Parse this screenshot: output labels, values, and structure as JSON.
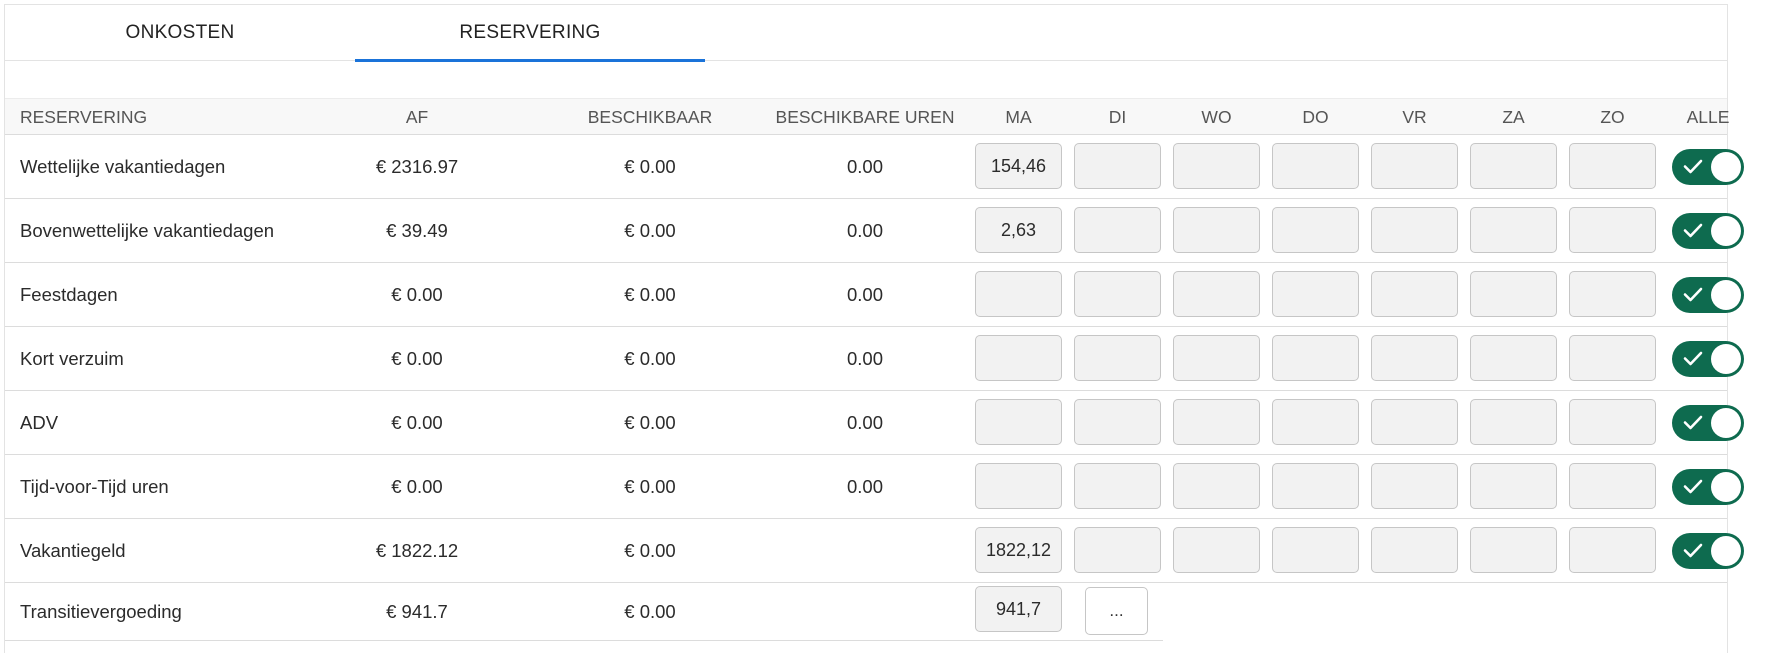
{
  "tabs": [
    {
      "label": "ONKOSTEN",
      "active": false
    },
    {
      "label": "RESERVERING",
      "active": true
    }
  ],
  "table": {
    "headers": {
      "reservering": "RESERVERING",
      "af": "AF",
      "beschikbaar": "BESCHIKBAAR",
      "beschikbare_uren": "BESCHIKBARE UREN",
      "ma": "MA",
      "di": "DI",
      "wo": "WO",
      "do": "DO",
      "vr": "VR",
      "za": "ZA",
      "zo": "ZO",
      "alle": "ALLE"
    },
    "rows": [
      {
        "name": "Wettelijke vakantiedagen",
        "af": "€ 2316.97",
        "beschikbaar": "€ 0.00",
        "uren": "0.00",
        "ma": "154,46",
        "di": "",
        "wo": "",
        "do": "",
        "vr": "",
        "za": "",
        "zo": "",
        "alle": true
      },
      {
        "name": "Bovenwettelijke vakantiedagen",
        "af": "€ 39.49",
        "beschikbaar": "€ 0.00",
        "uren": "0.00",
        "ma": "2,63",
        "di": "",
        "wo": "",
        "do": "",
        "vr": "",
        "za": "",
        "zo": "",
        "alle": true
      },
      {
        "name": "Feestdagen",
        "af": "€ 0.00",
        "beschikbaar": "€ 0.00",
        "uren": "0.00",
        "ma": "",
        "di": "",
        "wo": "",
        "do": "",
        "vr": "",
        "za": "",
        "zo": "",
        "alle": true
      },
      {
        "name": "Kort verzuim",
        "af": "€ 0.00",
        "beschikbaar": "€ 0.00",
        "uren": "0.00",
        "ma": "",
        "di": "",
        "wo": "",
        "do": "",
        "vr": "",
        "za": "",
        "zo": "",
        "alle": true
      },
      {
        "name": "ADV",
        "af": "€ 0.00",
        "beschikbaar": "€ 0.00",
        "uren": "0.00",
        "ma": "",
        "di": "",
        "wo": "",
        "do": "",
        "vr": "",
        "za": "",
        "zo": "",
        "alle": true
      },
      {
        "name": "Tijd-voor-Tijd uren",
        "af": "€ 0.00",
        "beschikbaar": "€ 0.00",
        "uren": "0.00",
        "ma": "",
        "di": "",
        "wo": "",
        "do": "",
        "vr": "",
        "za": "",
        "zo": "",
        "alle": true
      },
      {
        "name": "Vakantiegeld",
        "af": "€ 1822.12",
        "beschikbaar": "€ 0.00",
        "uren": "",
        "ma": "1822,12",
        "di": "",
        "wo": "",
        "do": "",
        "vr": "",
        "za": "",
        "zo": "",
        "alle": true
      },
      {
        "name": "Transitievergoeding",
        "af": "€ 941.7",
        "beschikbaar": "€ 0.00",
        "uren": "",
        "ma": "941,7",
        "more_label": "..."
      }
    ]
  },
  "colors": {
    "tab_active_underline": "#1a73d9",
    "toggle_on": "#0e6b4f"
  },
  "icons": {
    "toggle_check": "check-icon"
  }
}
